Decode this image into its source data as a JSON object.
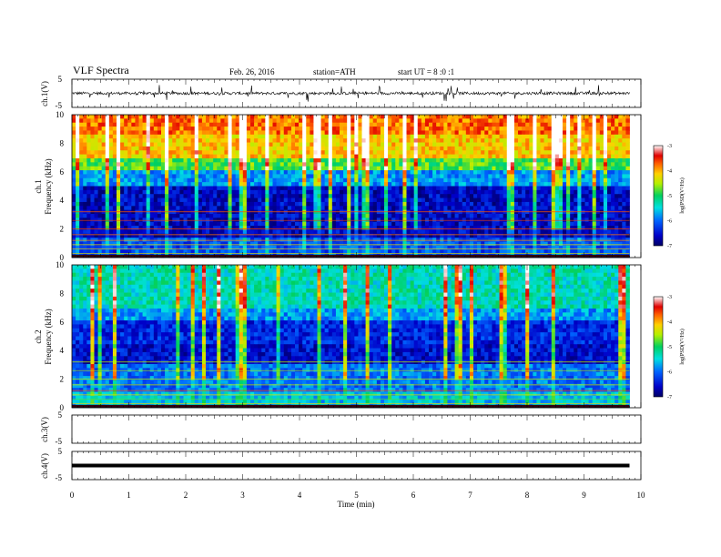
{
  "header": {
    "title": "VLF Spectra",
    "date": "Feb. 26, 2016",
    "station": "station=ATH",
    "start": "start UT = 8 :0 :1"
  },
  "chart_data": [
    {
      "type": "line",
      "panel": "ch1-waveform",
      "ylabel": "ch.1(V)",
      "ylim": [
        -5,
        5
      ],
      "yticks": [
        "5",
        "-5"
      ],
      "xlim": [
        0,
        10
      ],
      "series_description": "noisy signal near 0 V with spikes up to about -3 V / +3 V",
      "data_end_x": 9.8
    },
    {
      "type": "heatmap",
      "panel": "ch1-spectrogram",
      "ylabel_line1": "ch.1",
      "ylabel_line2": "Frequency (kHz)",
      "ylim": [
        0,
        10
      ],
      "yticks": [
        "0",
        "2",
        "4",
        "6",
        "8",
        "10"
      ],
      "xlim": [
        0,
        10
      ],
      "data_end_x": 9.8,
      "colorbar": {
        "label": "log(PSD(V²/Hz)",
        "ticks": [
          "-3",
          "-4",
          "-5",
          "-6",
          "-7"
        ],
        "range": [
          -7,
          -3
        ]
      }
    },
    {
      "type": "heatmap",
      "panel": "ch2-spectrogram",
      "ylabel_line1": "ch.2",
      "ylabel_line2": "Frequency (kHz)",
      "ylim": [
        0,
        10
      ],
      "yticks": [
        "0",
        "2",
        "4",
        "6",
        "8",
        "10"
      ],
      "xlim": [
        0,
        10
      ],
      "data_end_x": 9.8,
      "colorbar": {
        "label": "log(PSD(V²/Hz)",
        "ticks": [
          "-3",
          "-4",
          "-5",
          "-6",
          "-7"
        ],
        "range": [
          -7,
          -3
        ]
      }
    },
    {
      "type": "line",
      "panel": "ch3-waveform",
      "ylabel": "ch.3(V)",
      "ylim": [
        -5,
        5
      ],
      "yticks": [
        "5",
        "-5"
      ],
      "xlim": [
        0,
        10
      ],
      "series_description": "no visible trace"
    },
    {
      "type": "line",
      "panel": "ch4-waveform",
      "ylabel": "ch.4(V)",
      "ylim": [
        -5,
        5
      ],
      "yticks": [
        "5",
        "-5"
      ],
      "xlim": [
        0,
        10
      ],
      "series_description": "flat trace at about 0 V",
      "constant_value": 0,
      "data_end_x": 9.8
    }
  ],
  "xaxis": {
    "label": "Time (min)",
    "ticks": [
      "0",
      "1",
      "2",
      "3",
      "4",
      "5",
      "6",
      "7",
      "8",
      "9",
      "10"
    ]
  },
  "colors": {
    "trace": "#000000",
    "axis": "#000000"
  }
}
